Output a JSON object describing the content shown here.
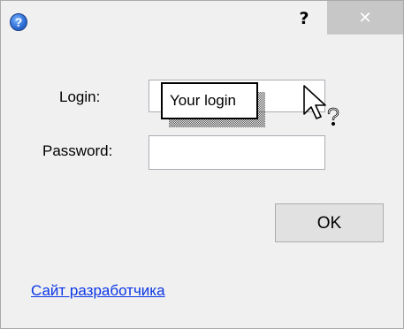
{
  "titlebar": {
    "app_icon": "help-circle-icon",
    "help_label": "?",
    "close_label": "✕"
  },
  "form": {
    "login_label": "Login:",
    "password_label": "Password:",
    "login_value": "",
    "password_value": ""
  },
  "tooltip": {
    "text": "Your login"
  },
  "cursor": {
    "icon": "help-select-cursor-icon"
  },
  "buttons": {
    "ok_label": "OK"
  },
  "footer": {
    "developer_link": "Сайт разработчика"
  },
  "colors": {
    "window_bg": "#f0f0f0",
    "close_button_bg": "#c7c7c7",
    "link": "#0a35e5"
  }
}
